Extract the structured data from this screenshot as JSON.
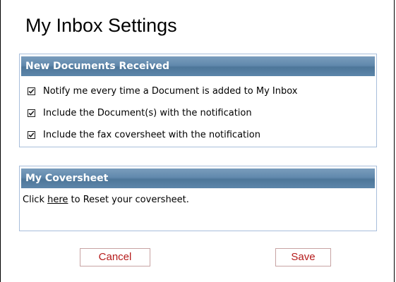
{
  "page": {
    "title": "My Inbox Settings"
  },
  "new_documents": {
    "header": "New Documents Received",
    "options": [
      {
        "label": "Notify me every time a Document is added to My Inbox",
        "checked": true
      },
      {
        "label": "Include the Document(s) with the notification",
        "checked": true
      },
      {
        "label": "Include the fax coversheet with the notification",
        "checked": true
      }
    ]
  },
  "coversheet": {
    "header": "My Coversheet",
    "text_before": "Click ",
    "link_text": "here",
    "text_after": " to Reset your coversheet."
  },
  "buttons": {
    "cancel": "Cancel",
    "save": "Save"
  },
  "colors": {
    "header_bar": "#5a84a8",
    "panel_border": "#a8bedb",
    "button_text": "#b51a1a",
    "button_border": "#c7a3a3"
  }
}
